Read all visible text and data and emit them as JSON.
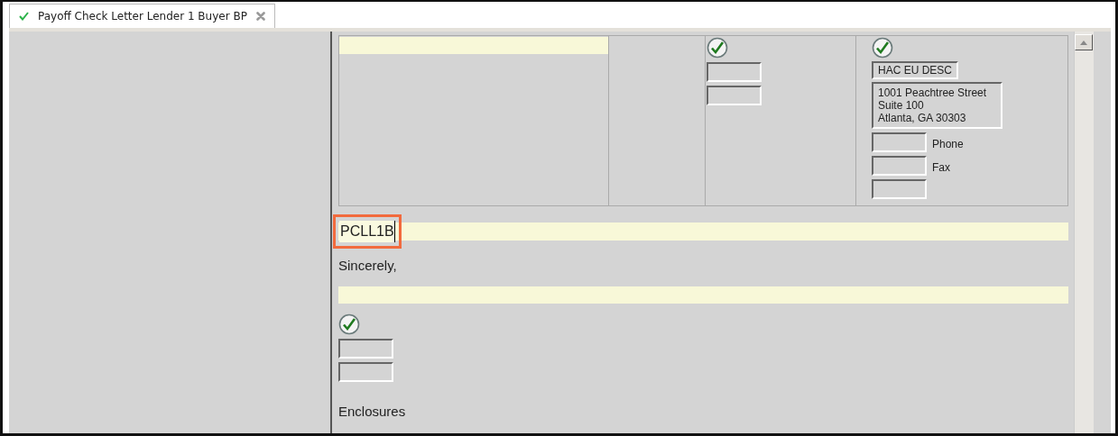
{
  "tabs": [
    {
      "label": "Payoff Check Letter Lender 1 Buyer BP",
      "selected": true,
      "complete": true
    }
  ],
  "table": {
    "columns": [
      {
        "kind": "yellow-field"
      },
      {
        "kind": "empty"
      },
      {
        "kind": "signer",
        "checked": true,
        "fields": [
          {
            "kind": "blank"
          },
          {
            "kind": "blank"
          }
        ]
      },
      {
        "kind": "contact",
        "checked": true,
        "name": "HAC EU DESC",
        "address": [
          "1001 Peachtree Street",
          "Suite 100",
          "Atlanta, GA 30303"
        ],
        "fields": [
          {
            "kind": "blank",
            "label": "Phone"
          },
          {
            "kind": "blank",
            "label": "Fax"
          },
          {
            "kind": "blank"
          }
        ]
      }
    ]
  },
  "reference_field": {
    "value": "PCLL1B",
    "highlighted": true
  },
  "closing": "Sincerely,",
  "signature": {
    "checked": true,
    "fields": [
      {
        "kind": "blank"
      },
      {
        "kind": "blank"
      }
    ]
  },
  "enclosures": "Enclosures"
}
